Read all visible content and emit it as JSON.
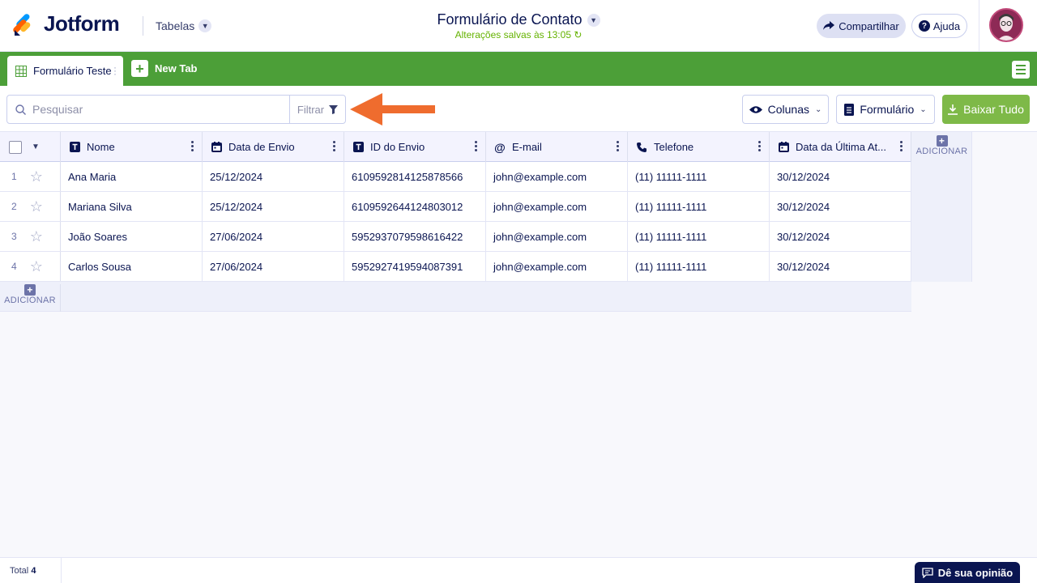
{
  "header": {
    "brand": "Jotform",
    "section": "Tabelas",
    "form_title": "Formulário de Contato",
    "saved_status": "Alterações salvas às 13:05",
    "share_label": "Compartilhar",
    "help_label": "Ajuda"
  },
  "tabs": {
    "active_label": "Formulário Teste",
    "new_tab_label": "New Tab"
  },
  "toolbar": {
    "search_placeholder": "Pesquisar",
    "filter_label": "Filtrar",
    "columns_label": "Colunas",
    "form_label": "Formulário",
    "download_label": "Baixar Tudo"
  },
  "table": {
    "columns": [
      {
        "label": "Nome",
        "icon": "text-icon"
      },
      {
        "label": "Data de Envio",
        "icon": "calendar-icon"
      },
      {
        "label": "ID do Envio",
        "icon": "text-icon"
      },
      {
        "label": "E-mail",
        "icon": "at-icon"
      },
      {
        "label": "Telefone",
        "icon": "phone-icon"
      },
      {
        "label": "Data da Última At...",
        "icon": "calendar-icon"
      }
    ],
    "rows": [
      {
        "num": "1",
        "cells": [
          "Ana Maria",
          "25/12/2024",
          "6109592814125878566",
          "john@example.com",
          "(11) 11111-1111",
          "30/12/2024"
        ]
      },
      {
        "num": "2",
        "cells": [
          "Mariana Silva",
          "25/12/2024",
          "6109592644124803012",
          "john@example.com",
          "(11) 11111-1111",
          "30/12/2024"
        ]
      },
      {
        "num": "3",
        "cells": [
          "João Soares",
          "27/06/2024",
          "5952937079598616422",
          "john@example.com",
          "(11) 11111-1111",
          "30/12/2024"
        ]
      },
      {
        "num": "4",
        "cells": [
          "Carlos Sousa",
          "27/06/2024",
          "5952927419594087391",
          "john@example.com",
          "(11) 11111-1111",
          "30/12/2024"
        ]
      }
    ],
    "add_column_label": "ADICIONAR",
    "add_row_label": "ADICIONAR"
  },
  "footer": {
    "total_label": "Total",
    "total_count": "4",
    "feedback_label": "Dê sua opinião"
  },
  "colors": {
    "brand_green": "#4c9f38",
    "download_green": "#7eb948",
    "navy": "#0a1551",
    "annotation_arrow": "#ef6c2e"
  }
}
